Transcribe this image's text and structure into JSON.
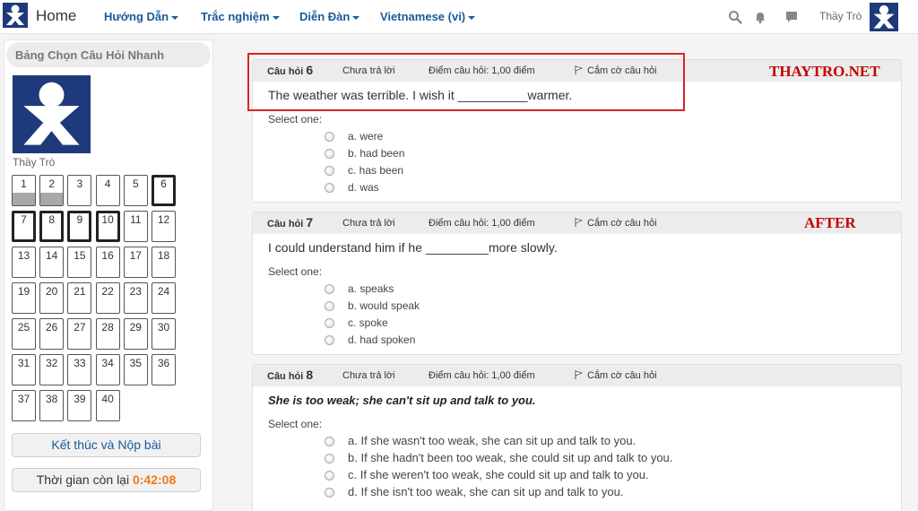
{
  "nav": {
    "home": "Home",
    "menu": [
      "Hướng Dẫn",
      "Trắc nghiệm",
      "Diễn Đàn",
      "Vietnamese (vi)"
    ],
    "user": "Thầy Trò",
    "icons": [
      "search-icon",
      "bell-icon",
      "chat-icon"
    ]
  },
  "sidebar": {
    "title": "Bảng Chọn Câu Hỏi Nhanh",
    "profile_name": "Thầy Trò",
    "questions": [
      "1",
      "2",
      "3",
      "4",
      "5",
      "6",
      "7",
      "8",
      "9",
      "10",
      "11",
      "12",
      "13",
      "14",
      "15",
      "16",
      "17",
      "18",
      "19",
      "20",
      "21",
      "22",
      "23",
      "24",
      "25",
      "26",
      "27",
      "28",
      "29",
      "30",
      "31",
      "32",
      "33",
      "34",
      "35",
      "36",
      "37",
      "38",
      "39",
      "40"
    ],
    "answered": [
      "1",
      "2"
    ],
    "flagged_current": [
      "6",
      "7",
      "8",
      "9",
      "10"
    ],
    "finish_label": "Kết thúc và Nộp bài",
    "timer_label": "Thời gian còn lại",
    "timer_value": "0:42:08"
  },
  "questions": [
    {
      "label": "Câu hỏi",
      "number": "6",
      "status": "Chưa trả lời",
      "points": "Điểm câu hỏi: 1,00 điểm",
      "flag": "Cắm cờ câu hỏi",
      "text": "The weather was terrible. I wish it __________warmer.",
      "select_one": "Select one:",
      "options": [
        "a. were",
        "b. had been",
        "c. has been",
        "d. was"
      ]
    },
    {
      "label": "Câu hỏi",
      "number": "7",
      "status": "Chưa trả lời",
      "points": "Điểm câu hỏi: 1,00 điểm",
      "flag": "Cắm cờ câu hỏi",
      "text": "I could understand him if he _________more slowly.",
      "select_one": "Select one:",
      "options": [
        "a. speaks",
        "b. would speak",
        "c. spoke",
        "d. had spoken"
      ]
    },
    {
      "label": "Câu hỏi",
      "number": "8",
      "status": "Chưa trả lời",
      "points": "Điểm câu hỏi: 1,00 điểm",
      "flag": "Cắm cờ câu hỏi",
      "text": "She is too weak; she can't sit up and talk to you.",
      "select_one": "Select one:",
      "options": [
        "a. If she wasn't too weak, she can sit up and talk to you.",
        "b. If she hadn't been too weak, she could sit up and talk to you.",
        "c. If she weren't too weak, she could sit up and talk to you.",
        "d. If she isn't too weak, she can sit up and talk to you."
      ]
    }
  ],
  "watermarks": [
    "THAYTRO.NET",
    "AFTER"
  ],
  "colors": {
    "brand": "#1f3a7a",
    "link": "#1a5a9a",
    "timer": "#f07a1a",
    "annotation": "#c40000"
  }
}
